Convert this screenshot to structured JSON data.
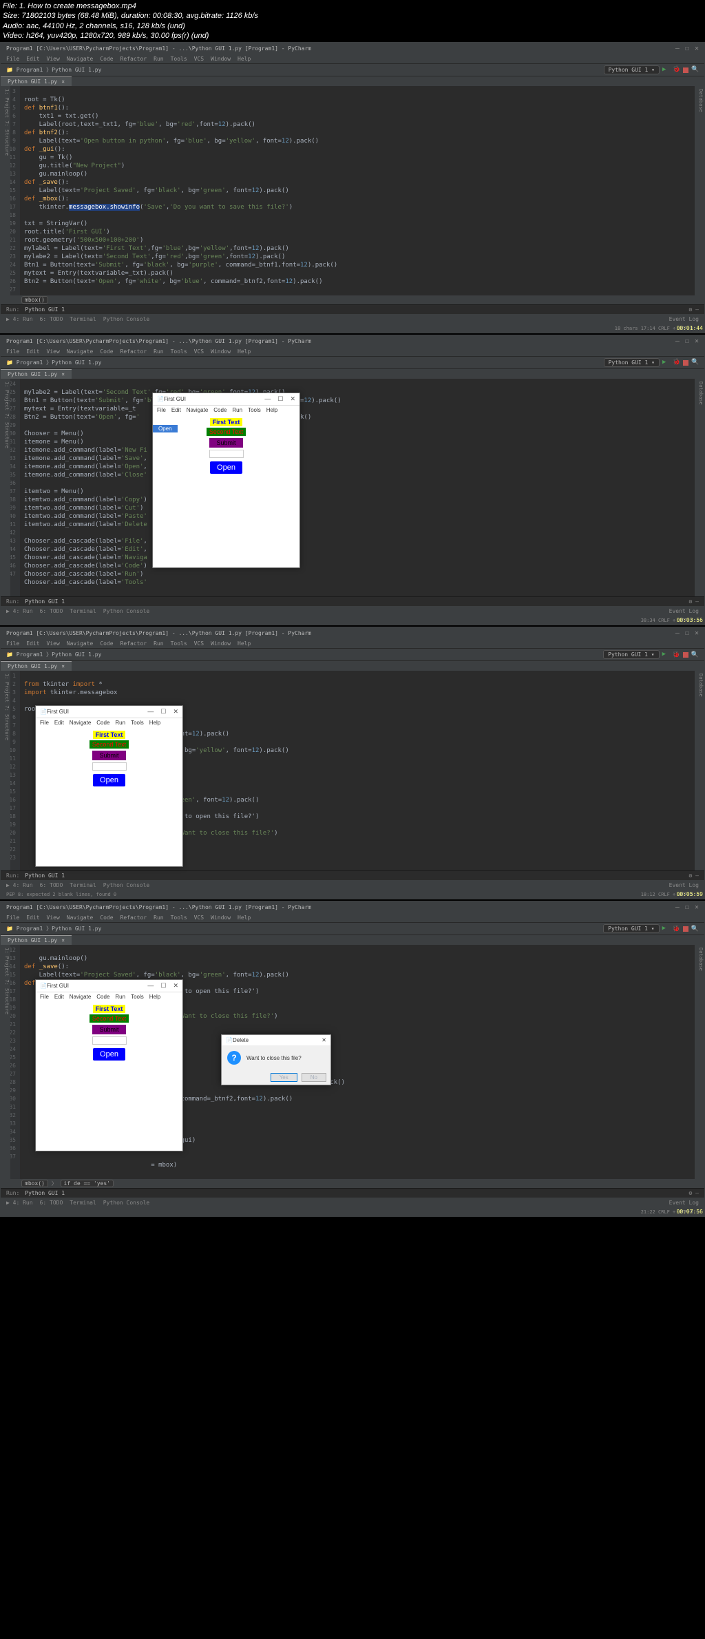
{
  "metadata": {
    "line1": "File: 1. How to create messagebox.mp4",
    "line2": "Size: 71802103 bytes (68.48 MiB), duration: 00:08:30, avg.bitrate: 1126 kb/s",
    "line3": "Audio: aac, 44100 Hz, 2 channels, s16, 128 kb/s (und)",
    "line4": "Video: h264, yuv420p, 1280x720, 989 kb/s, 30.00 fps(r) (und)"
  },
  "ide": {
    "title": "Program1 [C:\\Users\\USER\\PycharmProjects\\Program1] - ...\\Python GUI 1.py [Program1] - PyCharm",
    "menu": [
      "File",
      "Edit",
      "View",
      "Navigate",
      "Code",
      "Refactor",
      "Run",
      "Tools",
      "VCS",
      "Window",
      "Help"
    ],
    "crumbs": [
      "Program1",
      "Python GUI 1.py"
    ],
    "runcfg": "Python GUI 1",
    "filetab": "Python GUI 1.py",
    "side_l": "1: Project   7: Structure",
    "side_r": "Database",
    "btabs": [
      "4: Run",
      "6: TODO",
      "Terminal",
      "Python Console"
    ],
    "eventlog": "Event Log",
    "runlabel": "Run:",
    "pep": "PEP 8: expected 2 blank lines, found 0"
  },
  "tk": {
    "title": "First GUI",
    "menu": [
      "File",
      "Edit",
      "Navigate",
      "Code",
      "Run",
      "Tools",
      "Help"
    ],
    "ftxt": "First Text",
    "stxt": "Second Text",
    "submit": "Submit",
    "open": "Open",
    "open_menu": "Open"
  },
  "msgbox": {
    "title": "Delete",
    "text": "Want to close this file?",
    "yes": "Yes",
    "no": "No"
  },
  "code1": {
    "line2": "root = Tk()",
    "line3": "def btnf1():",
    "line4": "    txt1 = txt.get()",
    "line5": "    Label(root,text=_txt1, fg='blue', bg='red',font=12).pack()",
    "line6": "def btnf2():",
    "line7": "    Label(text='Open button in python', fg='blue', bg='yellow', font=12).pack()",
    "line8": "def _gui():",
    "line9": "    gu = Tk()",
    "line10": "    gu.title(\"New Project\")",
    "line11": "    gu.mainloop()",
    "line12": "def _save():",
    "line13": "    Label(text='Project Saved', fg='black', bg='green', font=12).pack()",
    "line14": "def _mbox():",
    "line15_a": "    tkinter.",
    "line15_sel": "messagebox.showinfo",
    "line15_b": "('Save','Do you want to save this file?')",
    "line17": "txt = StringVar()",
    "line18": "root.title('First GUI')",
    "line19": "root.geometry('500x500+100+200')",
    "line20": "mylabel = Label(text='First Text',fg='blue',bg='yellow',font=12).pack()",
    "line21": "mylabe2 = Label(text='Second Text',fg='red',bg='green',font=12).pack()",
    "line22": "Btn1 = Button(text='Submit', fg='black', bg='purple', command=_btnf1,font=12).pack()",
    "line23": "mytext = Entry(textvariable=_txt).pack()",
    "line24": "Btn2 = Button(text='Open', fg='white', bg='blue', command=_btnf2,font=12).pack()",
    "mbox_ctx": "mbox()",
    "status": "18 chars     17:14    CRLF ÷   UTF-8 ÷"
  },
  "code2": {
    "l24": "mylabe2 = Label(text='Second Text',fg='red',bg='green',font=12).pack()",
    "l25": "Btn1 = Button(text='Submit', fg='black', bg='purple', command = btnf1,font=12).pack()",
    "l26": "mytext = Entry(textvariable=_t",
    "l27": "Btn2 = Button(text='Open', fg='",
    "l27b": ".pack()",
    "l29": "Chooser = Menu()",
    "l30": "itemone = Menu()",
    "l31": "itemone.add_command(label='New Fi",
    "l32": "itemone.add_command(label='Save',",
    "l33": "itemone.add_command(label='Open',",
    "l34": "itemone.add_command(label='Close'",
    "l36": "itemtwo = Menu()",
    "l37": "itemtwo.add_command(label='Copy')",
    "l38": "itemtwo.add_command(label='Cut')",
    "l39": "itemtwo.add_command(label='Paste'",
    "l40": "itemtwo.add_command(label='Delete",
    "l42": "Chooser.add_cascade(label='File',",
    "l43": "Chooser.add_cascade(label='Edit',",
    "l44": "Chooser.add_cascade(label='Naviga",
    "l45": "Chooser.add_cascade(label='Code')",
    "l46": "Chooser.add_cascade(label='Run')",
    "l47": "Chooser.add_cascade(label='Tools'",
    "status": "38:34    CRLF ÷   UTF-8 ÷"
  },
  "code3": {
    "l1": "from tkinter import *",
    "l2": "import tkinter.messagebox",
    "l4": "root = Tk()",
    "l7": "'red',font=12).pack()",
    "l9": "='blue', bg='yellow', font=12).pack()",
    "l15": ", bg='green', font=12).pack()",
    "l17": "you want to open this file?')",
    "l19": "elete','Want to close this file?')",
    "status": "18:12    CRLF ÷   UTF-8 ÷"
  },
  "code4": {
    "l12": "    gu.mainloop()",
    "l13": "def _save():",
    "l14": "    Label(text='Project Saved', fg='black', bg='green', font=12).pack()",
    "l15": "def _mbox():",
    "l16": "you want to open this file?')",
    "l19": "elete','Want to close this file?')",
    "l25": ".pack()",
    "l26": ".pack()",
    "l27": ", command = btnf1,font=12).pack()",
    "l29": "'blue', command=_btnf2,font=12).pack()",
    "l34": "ommand=_gui)",
    "l35": "=_save)",
    "l37": "= mbox)",
    "ctx": "if de == 'yes'",
    "mbox_ctx": "mbox()",
    "status": "21:22    CRLF ÷   UTF-8 ÷"
  },
  "ts": {
    "t1": "00:01:44",
    "t2": "00:03:56",
    "t3": "00:05:59",
    "t4": "00:07:56"
  }
}
